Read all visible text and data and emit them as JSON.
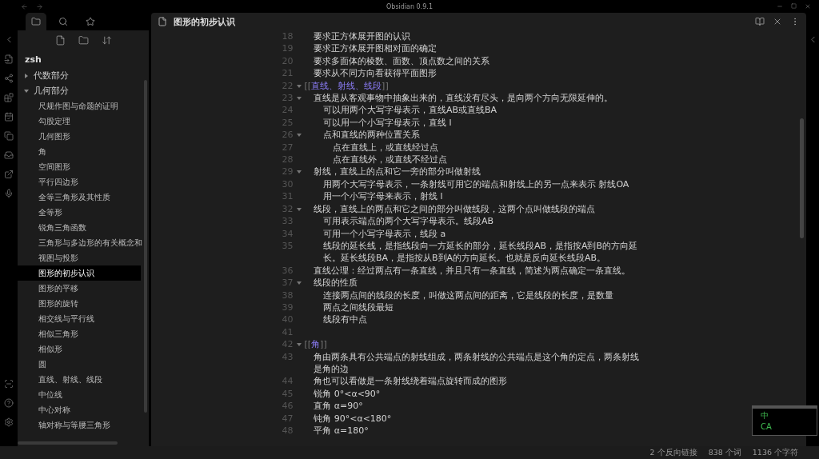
{
  "window": {
    "title": "Obsidian 0.9.1"
  },
  "sidebar": {
    "vault": "zsh",
    "tree": [
      {
        "name": "代数部分",
        "expanded": false
      },
      {
        "name": "几何部分",
        "expanded": true,
        "children": [
          {
            "name": "尺规作图与命题的证明",
            "selected": false
          },
          {
            "name": "勾股定理",
            "selected": false
          },
          {
            "name": "几何图形",
            "selected": false
          },
          {
            "name": "角",
            "selected": false
          },
          {
            "name": "空间图形",
            "selected": false
          },
          {
            "name": "平行四边形",
            "selected": false
          },
          {
            "name": "全等三角形及其性质",
            "selected": false
          },
          {
            "name": "全等形",
            "selected": false
          },
          {
            "name": "锐角三角函数",
            "selected": false
          },
          {
            "name": "三角形与多边形的有关概念和",
            "selected": false
          },
          {
            "name": "视图与投影",
            "selected": false
          },
          {
            "name": "图形的初步认识",
            "selected": true
          },
          {
            "name": "图形的平移",
            "selected": false
          },
          {
            "name": "图形的旋转",
            "selected": false
          },
          {
            "name": "相交线与平行线",
            "selected": false
          },
          {
            "name": "相似三角形",
            "selected": false
          },
          {
            "name": "相似形",
            "selected": false
          },
          {
            "name": "圆",
            "selected": false
          },
          {
            "name": "直线、射线、线段",
            "selected": false
          },
          {
            "name": "中位线",
            "selected": false
          },
          {
            "name": "中心对称",
            "selected": false
          },
          {
            "name": "轴对称与等腰三角形",
            "selected": false
          }
        ]
      }
    ]
  },
  "editor": {
    "title": "图形的初步认识",
    "lines": [
      {
        "number": "18",
        "kind": "text",
        "text": "要求正方体展开图的认识"
      },
      {
        "number": "19",
        "kind": "text",
        "text": "要求正方体展开图相对面的确定"
      },
      {
        "number": "20",
        "kind": "text",
        "text": "要求多面体的棱数、面数、顶点数之间的关系"
      },
      {
        "number": "21",
        "kind": "text",
        "text": "要求从不同方向看获得平面图形"
      },
      {
        "number": "22",
        "kind": "link",
        "open": "[[",
        "link": "直线、射线、线段",
        "close": "]]",
        "expanded": true,
        "children": [
          {
            "number": "23",
            "kind": "text",
            "text": "直线是从客观事物中抽象出来的，直线没有尽头，是向两个方向无限延伸的。",
            "expanded": true,
            "children": [
              {
                "number": "24",
                "kind": "text",
                "text": "可以用两个大写字母表示，直线AB或直线BA"
              },
              {
                "number": "25",
                "kind": "text",
                "text": "可以用一个小写字母表示，直线 l"
              },
              {
                "number": "26",
                "kind": "text",
                "text": "点和直线的两种位置关系",
                "expanded": true,
                "children": [
                  {
                    "number": "27",
                    "kind": "text",
                    "text": "点在直线上，或直线经过点"
                  },
                  {
                    "number": "28",
                    "kind": "text",
                    "text": "点在直线外，或直线不经过点"
                  }
                ]
              }
            ]
          },
          {
            "number": "29",
            "kind": "text",
            "text": "射线，直线上的点和它一旁的部分叫做射线",
            "expanded": true,
            "children": [
              {
                "number": "30",
                "kind": "text",
                "text": "用两个大写字母表示，一条射线可用它的端点和射线上的另一点来表示 射线OA"
              },
              {
                "number": "31",
                "kind": "text",
                "text": "用一个小写字母来表示，射线 l"
              }
            ]
          },
          {
            "number": "32",
            "kind": "text",
            "text": "线段，直线上的两点和它之间的部分叫做线段，这两个点叫做线段的端点",
            "expanded": true,
            "children": [
              {
                "number": "33",
                "kind": "text",
                "text": "可用表示端点的两个大写字母表示。线段AB"
              },
              {
                "number": "34",
                "kind": "text",
                "text": "可用一个小写字母表示，线段 a"
              },
              {
                "number": "35",
                "kind": "text",
                "text": "线段的延长线，是指线段向一方延长的部分，延长线段AB，是指按A到B的方向延长。延长线段BA，是指按从B到A的方向延长。也就是反向延长线段AB。"
              }
            ]
          },
          {
            "number": "36",
            "kind": "text",
            "text": "直线公理：经过两点有一条直线，并且只有一条直线，简述为两点确定一条直线。"
          },
          {
            "number": "37",
            "kind": "text",
            "text": "线段的性质",
            "expanded": true,
            "children": [
              {
                "number": "38",
                "kind": "text",
                "text": "连接两点间的线段的长度，叫做这两点间的距离，它是线段的长度，是数量"
              },
              {
                "number": "39",
                "kind": "text",
                "text": "两点之间线段最短"
              },
              {
                "number": "40",
                "kind": "text",
                "text": "线段有中点"
              }
            ]
          }
        ]
      },
      {
        "number": "41",
        "kind": "empty"
      },
      {
        "number": "42",
        "kind": "link",
        "open": "[[",
        "link": "角",
        "close": "]]",
        "expanded": true,
        "children": [
          {
            "number": "43",
            "kind": "text",
            "text": "角由两条具有公共端点的射线组成，两条射线的公共端点是这个角的定点，两条射线是角的边"
          },
          {
            "number": "44",
            "kind": "text",
            "text": "角也可以看做是一条射线绕着端点旋转而成的图形"
          },
          {
            "number": "45",
            "kind": "text",
            "text": "锐角 0°<α<90°"
          },
          {
            "number": "46",
            "kind": "text",
            "text": "直角 α=90°"
          },
          {
            "number": "47",
            "kind": "text",
            "text": "钝角 90°<α<180°"
          },
          {
            "number": "48",
            "kind": "text",
            "text": "平角 α=180°"
          }
        ]
      }
    ]
  },
  "status_bar": {
    "backlinks": "2 个反向链接",
    "words": "838 个词",
    "characters": "1136 个字符"
  },
  "ime": {
    "mode": "中",
    "case": "CA"
  }
}
